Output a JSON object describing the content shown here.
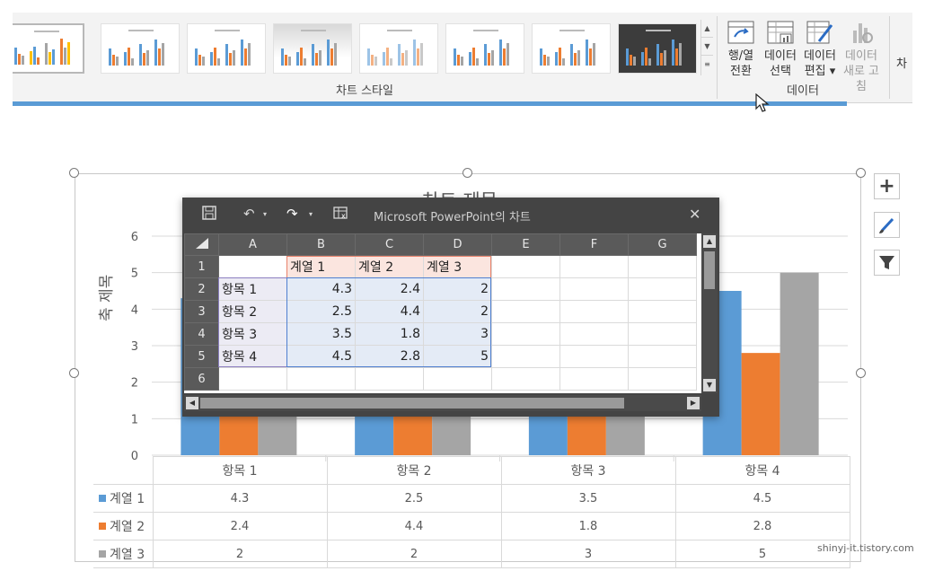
{
  "ribbon": {
    "chart_style_group": "차트 스타일",
    "data_group": "데이터",
    "buttons": {
      "switch_row_col_1": "행/열",
      "switch_row_col_2": "전환",
      "select_data_1": "데이터",
      "select_data_2": "선택",
      "edit_data_1": "데이터",
      "edit_data_2": "편집 ▾",
      "refresh_data_1": "데이터",
      "refresh_data_2": "새로 고침"
    },
    "cut_label": "차"
  },
  "chart": {
    "title": "차트 제목",
    "y_axis_title": "축 제목",
    "table_categories": [
      "항목 1",
      "항목 2",
      "항목 3",
      "항목 4"
    ],
    "table_rows": [
      {
        "name": "계열 1",
        "values": [
          "4.3",
          "2.5",
          "3.5",
          "4.5"
        ]
      },
      {
        "name": "계열 2",
        "values": [
          "2.4",
          "4.4",
          "1.8",
          "2.8"
        ]
      },
      {
        "name": "계열 3",
        "values": [
          "2",
          "2",
          "3",
          "5"
        ]
      }
    ]
  },
  "chart_data": {
    "type": "bar",
    "title": "차트 제목",
    "ylabel": "축 제목",
    "xlabel": "",
    "categories": [
      "항목 1",
      "항목 2",
      "항목 3",
      "항목 4"
    ],
    "series": [
      {
        "name": "계열 1",
        "values": [
          4.3,
          2.5,
          3.5,
          4.5
        ],
        "color": "#5b9bd5"
      },
      {
        "name": "계열 2",
        "values": [
          2.4,
          4.4,
          1.8,
          2.8
        ],
        "color": "#ed7d31"
      },
      {
        "name": "계열 3",
        "values": [
          2,
          2,
          3,
          5
        ],
        "color": "#a5a5a5"
      }
    ],
    "ylim": [
      0,
      6
    ],
    "yticks": [
      "0",
      "1",
      "2",
      "3",
      "4",
      "5",
      "6"
    ],
    "grid": true,
    "legend": "data-table"
  },
  "sheet": {
    "title": "Microsoft PowerPoint의 차트",
    "columns": [
      "A",
      "B",
      "C",
      "D",
      "E",
      "F",
      "G"
    ],
    "rows": [
      {
        "n": "1",
        "cells": [
          "",
          "계열 1",
          "계열 2",
          "계열 3",
          "",
          "",
          ""
        ]
      },
      {
        "n": "2",
        "cells": [
          "항목 1",
          "4.3",
          "2.4",
          "2",
          "",
          "",
          ""
        ]
      },
      {
        "n": "3",
        "cells": [
          "항목 2",
          "2.5",
          "4.4",
          "2",
          "",
          "",
          ""
        ]
      },
      {
        "n": "4",
        "cells": [
          "항목 3",
          "3.5",
          "1.8",
          "3",
          "",
          "",
          ""
        ]
      },
      {
        "n": "5",
        "cells": [
          "항목 4",
          "4.5",
          "2.8",
          "5",
          "",
          "",
          ""
        ]
      },
      {
        "n": "6",
        "cells": [
          "",
          "",
          "",
          "",
          "",
          "",
          ""
        ]
      }
    ]
  },
  "watermark": "shinyj-it.tistory.com",
  "colors": {
    "series1": "#5b9bd5",
    "series2": "#ed7d31",
    "series3": "#a5a5a5",
    "accent": "#5a9bd5"
  }
}
